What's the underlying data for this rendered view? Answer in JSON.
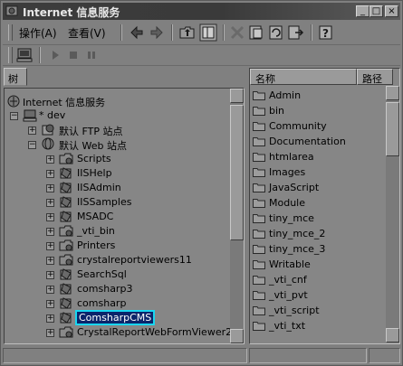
{
  "window": {
    "title": "Internet 信息服务",
    "controls": [
      "_",
      "□",
      "×"
    ]
  },
  "menubar": {
    "action": "操作(A)",
    "view": "查看(V)"
  },
  "toolbar": {
    "buttons": [
      "back-icon",
      "forward-icon",
      "up-folder-icon",
      "show-tree-icon",
      "delete-icon",
      "properties-icon",
      "refresh-icon",
      "export-icon",
      "help-icon"
    ]
  },
  "toolbar2": {
    "buttons": [
      "computer-icon",
      "play-icon",
      "stop-icon",
      "pause-icon"
    ]
  },
  "tree": {
    "tab_label": "树",
    "root": "Internet 信息服务",
    "server": "* dev",
    "ftp": "默认 FTP 站点",
    "web": "默认 Web 站点",
    "items": [
      "Scripts",
      "IISHelp",
      "IISAdmin",
      "IISSamples",
      "MSADC",
      "_vti_bin",
      "Printers",
      "crystalreportviewers11",
      "SearchSql",
      "comsharp3",
      "comsharp",
      "ComsharpCMS",
      "CrystalReportWebFormViewer2"
    ],
    "selected": "ComsharpCMS"
  },
  "list": {
    "col_name": "名称",
    "col_path": "路径",
    "items": [
      "Admin",
      "bin",
      "Community",
      "Documentation",
      "htmlarea",
      "Images",
      "JavaScript",
      "Module",
      "tiny_mce",
      "tiny_mce_2",
      "tiny_mce_3",
      "Writable",
      "_vti_cnf",
      "_vti_pvt",
      "_vti_script",
      "_vti_txt"
    ]
  },
  "colors": {
    "selection_outline": "#19d6f0",
    "selection_bg": "#0a246a"
  }
}
